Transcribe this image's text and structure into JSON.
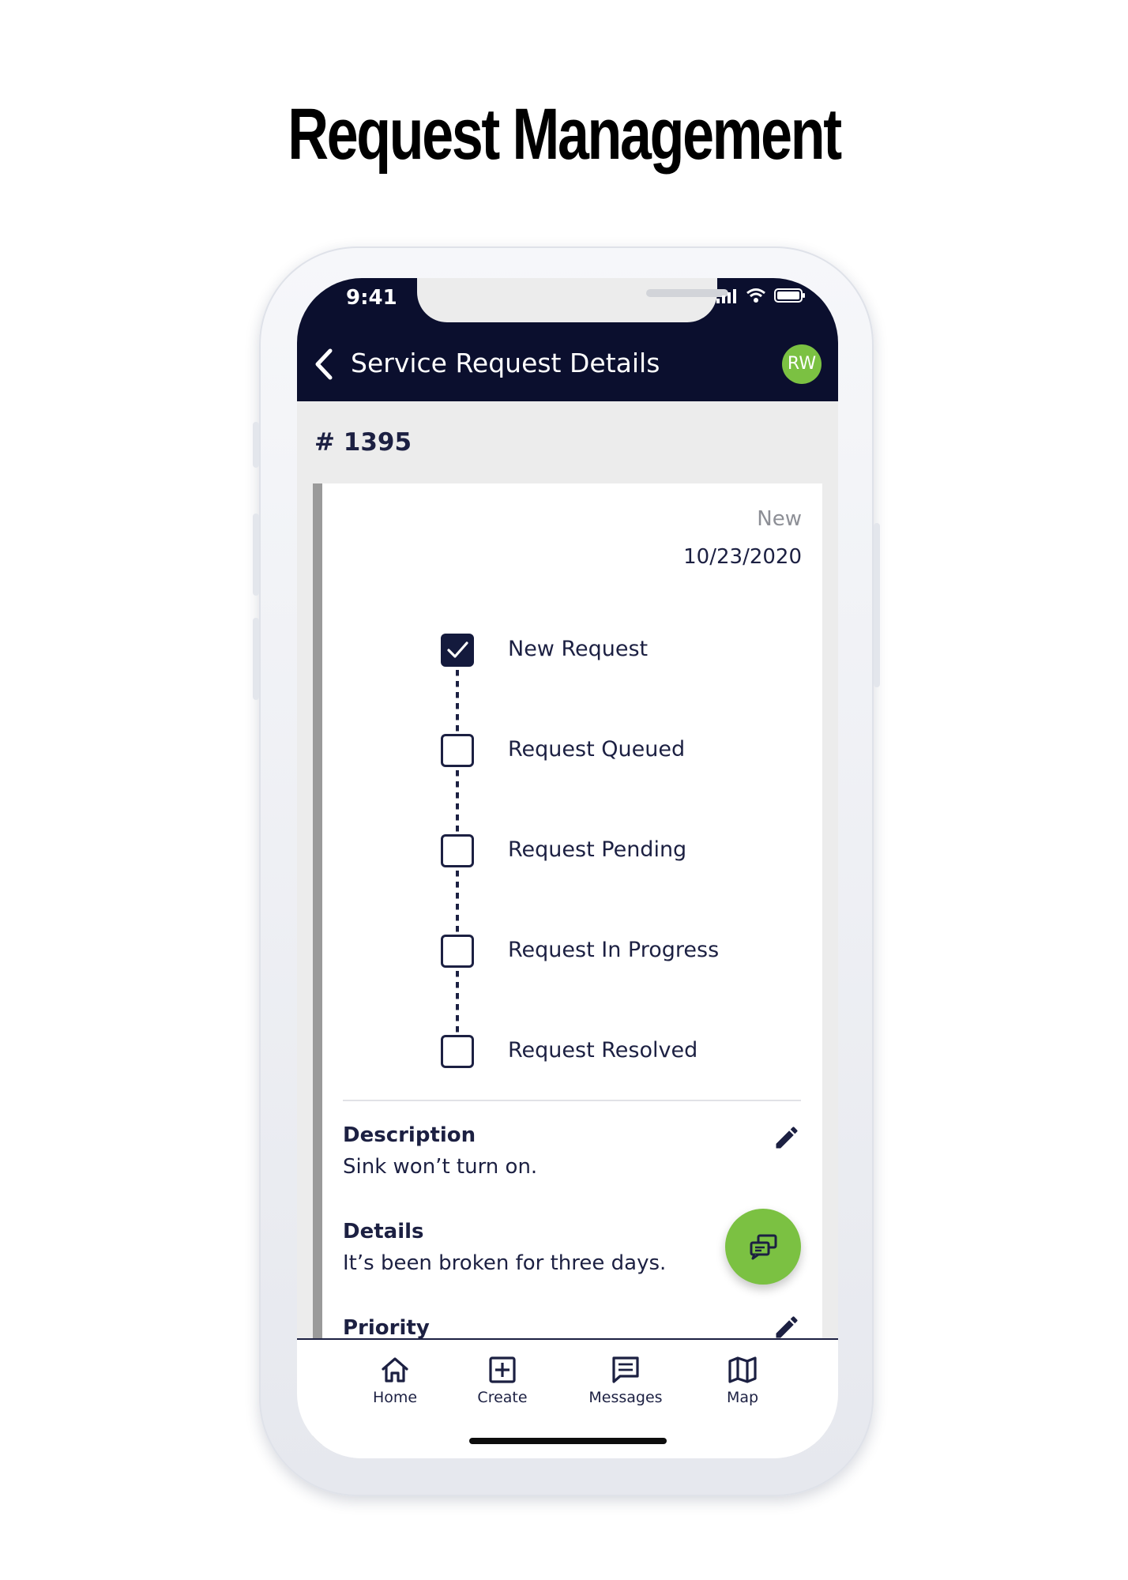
{
  "headline": "Request Management",
  "status_bar": {
    "time": "9:41"
  },
  "header": {
    "title": "Service Request Details",
    "avatar_initials": "RW"
  },
  "request": {
    "number": "# 1395",
    "status": "New",
    "date": "10/23/2020",
    "steps": [
      {
        "label": "New Request",
        "checked": true
      },
      {
        "label": "Request Queued",
        "checked": false
      },
      {
        "label": "Request Pending",
        "checked": false
      },
      {
        "label": "Request In Progress",
        "checked": false
      },
      {
        "label": "Request Resolved",
        "checked": false
      }
    ],
    "description": {
      "title": "Description",
      "value": "Sink won’t turn on."
    },
    "details": {
      "title": "Details",
      "value": "It’s been broken for three days."
    },
    "priority": {
      "title": "Priority"
    }
  },
  "tabbar": {
    "home": "Home",
    "create": "Create",
    "messages": "Messages",
    "map": "Map"
  },
  "colors": {
    "navy": "#0b0f2e",
    "accent_green": "#7bc142",
    "text": "#1c2042"
  }
}
